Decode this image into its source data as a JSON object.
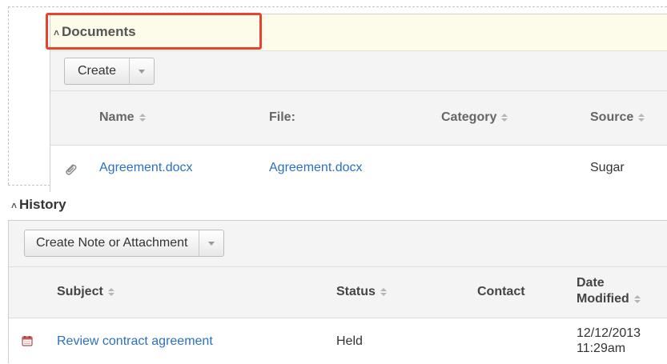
{
  "documents": {
    "title": "Documents",
    "collapse_icon": "double-chevron-up-icon",
    "create_label": "Create",
    "columns": {
      "name": "Name",
      "file": "File:",
      "category": "Category",
      "source": "Source"
    },
    "rows": [
      {
        "icon": "paperclip-icon",
        "name": "Agreement.docx",
        "file": "Agreement.docx",
        "category": "",
        "source": "Sugar"
      }
    ]
  },
  "history": {
    "title": "History",
    "collapse_icon": "double-chevron-up-icon",
    "create_label": "Create Note or Attachment",
    "columns": {
      "subject": "Subject",
      "status": "Status",
      "contact": "Contact",
      "date_modified_line1": "Date",
      "date_modified_line2": "Modified"
    },
    "rows": [
      {
        "icon": "calendar-icon",
        "subject": "Review contract agreement",
        "status": "Held",
        "contact": "",
        "date": "12/12/2013",
        "time": "11:29am"
      }
    ]
  },
  "colors": {
    "link": "#2c70c1",
    "highlight_border": "#e5432f",
    "documents_header_bg": "#fdfbe9"
  }
}
